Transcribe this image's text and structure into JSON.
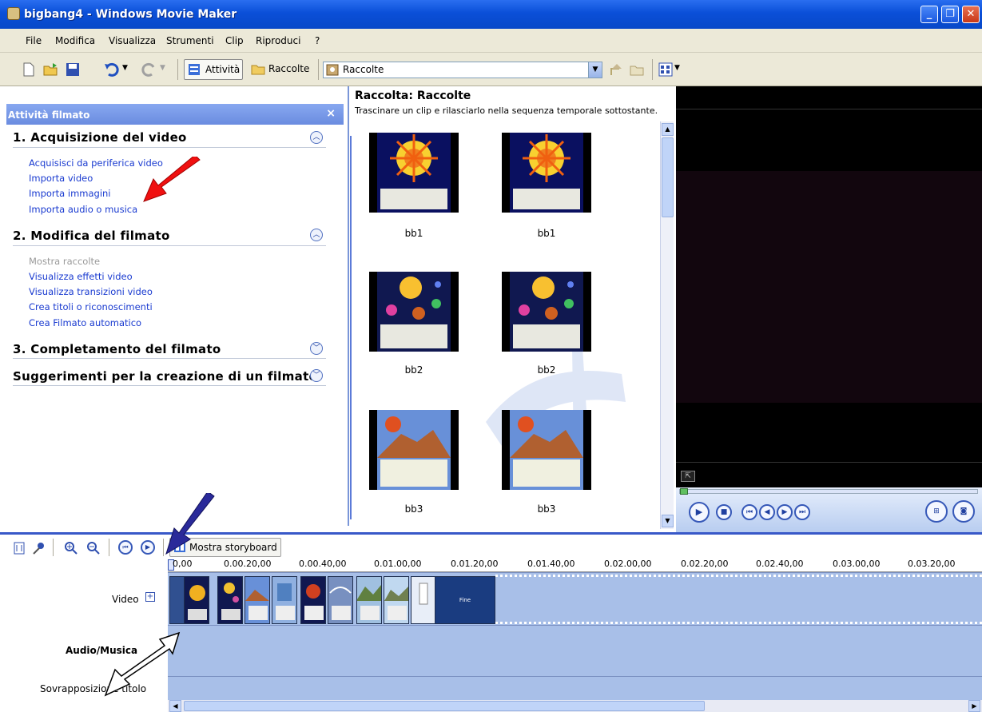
{
  "window": {
    "title": "bigbang4 - Windows Movie Maker",
    "min": "_",
    "max": "❐",
    "close": "✕"
  },
  "menu": [
    "File",
    "Modifica",
    "Visualizza",
    "Strumenti",
    "Clip",
    "Riproduci",
    "?"
  ],
  "toolbar": {
    "tasks_label": "Attività",
    "collections_label": "Raccolte",
    "collection_select": "Raccolte"
  },
  "taskpane": {
    "title": "Attività filmato",
    "close": "×",
    "sections": [
      {
        "title": "1. Acquisizione del video",
        "expanded": true,
        "links": [
          "Acquisisci da periferica video",
          "Importa video",
          "Importa immagini",
          "Importa audio o musica"
        ]
      },
      {
        "title": "2. Modifica del filmato",
        "expanded": true,
        "links": [
          "Mostra raccolte",
          "Visualizza effetti video",
          "Visualizza transizioni video",
          "Crea titoli o riconoscimenti",
          "Crea Filmato automatico"
        ]
      },
      {
        "title": "3. Completamento del filmato",
        "expanded": false
      },
      {
        "title": "Suggerimenti per la creazione di un filmato",
        "expanded": false
      }
    ]
  },
  "collection": {
    "title": "Raccolta: Raccolte",
    "subtitle": "Trascinare un clip e rilasciarlo nella sequenza temporale sottostante.",
    "items": [
      "bb1",
      "bb1",
      "bb2",
      "bb2",
      "bb3",
      "bb3"
    ]
  },
  "timeline": {
    "storyboard_button": "Mostra storyboard",
    "ticks": [
      "0,00",
      "0.00.20,00",
      "0.00.40,00",
      "0.01.00,00",
      "0.01.20,00",
      "0.01.40,00",
      "0.02.00,00",
      "0.02.20,00",
      "0.02.40,00",
      "0.03.00,00",
      "0.03.20,00"
    ],
    "tracks": {
      "video": "Video",
      "audio": "Audio/Musica",
      "title_overlay": "Sovrapposizione titolo"
    },
    "end_clip_label": "Fine"
  },
  "colors": {
    "titlebar": "#0a4fd8",
    "link": "#1a3bd0",
    "timeline_track": "#a8bfe8"
  }
}
